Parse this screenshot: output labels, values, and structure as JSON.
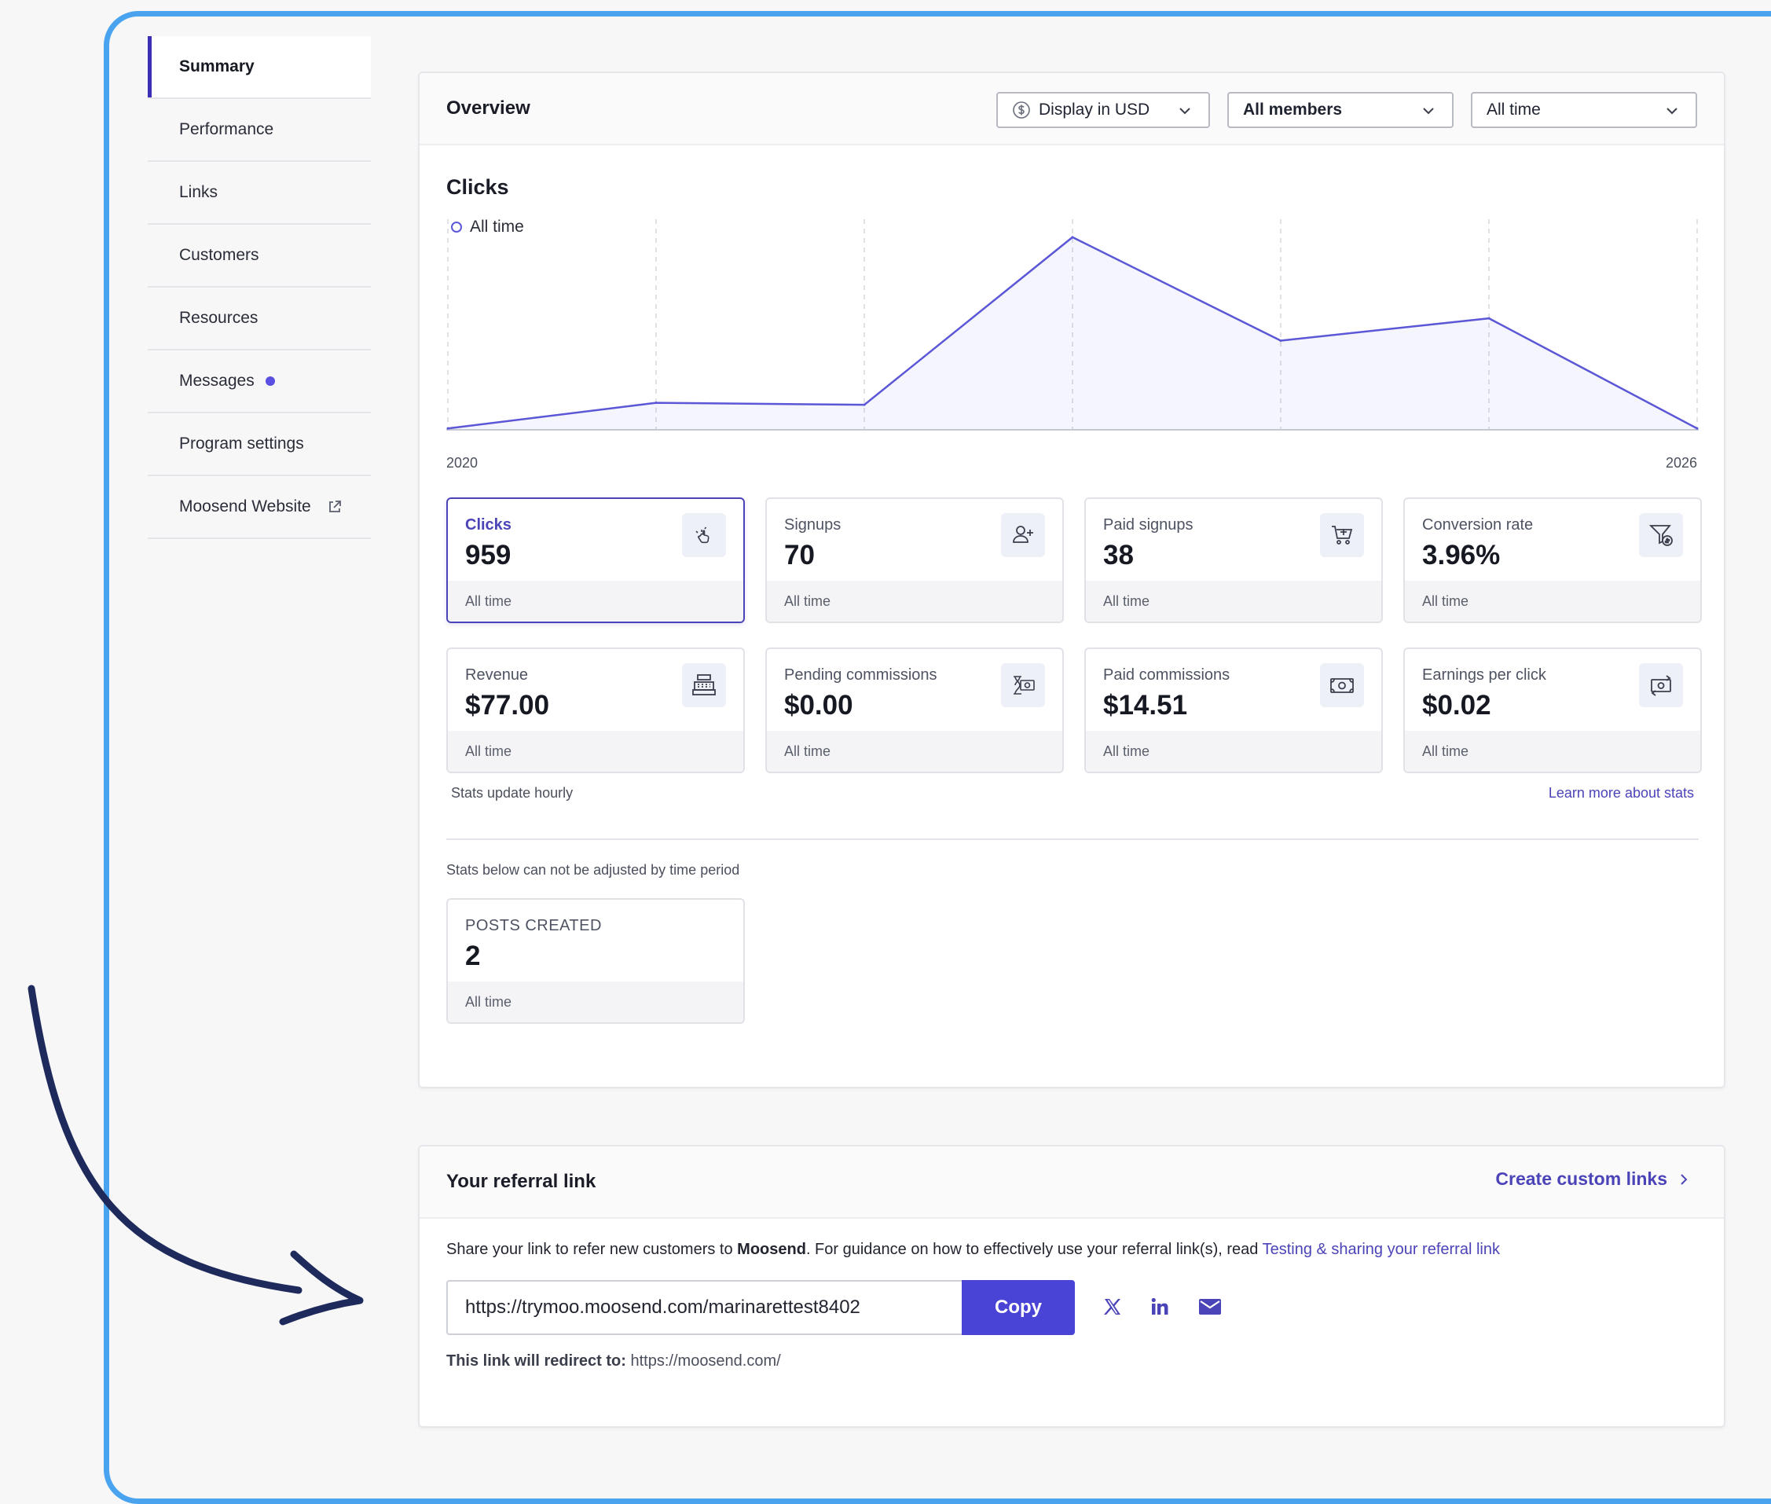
{
  "sidebar": {
    "items": [
      {
        "label": "Summary"
      },
      {
        "label": "Performance"
      },
      {
        "label": "Links"
      },
      {
        "label": "Customers"
      },
      {
        "label": "Resources"
      },
      {
        "label": "Messages"
      },
      {
        "label": "Program settings"
      },
      {
        "label": "Moosend Website"
      }
    ]
  },
  "overview": {
    "title": "Overview",
    "filters": {
      "currency": "Display in USD",
      "members": "All members",
      "period": "All time"
    },
    "chart_title": "Clicks",
    "legend": "All time",
    "x_start": "2020",
    "x_end": "2026"
  },
  "chart_data": {
    "type": "area",
    "title": "Clicks",
    "series": [
      {
        "name": "All time",
        "values": [
          2,
          40,
          37,
          285,
          132,
          165,
          2
        ]
      }
    ],
    "x": [
      "2020",
      "",
      "",
      "",
      "",
      "",
      "2026"
    ],
    "x_tick_labels": [
      "2020",
      "2026"
    ],
    "ylim": [
      0,
      300
    ],
    "grid": "vertical-dashed",
    "color": "#5b57d6"
  },
  "stats": [
    {
      "label": "Clicks",
      "value": "959",
      "period": "All time",
      "icon": "pointer-click-icon"
    },
    {
      "label": "Signups",
      "value": "70",
      "period": "All time",
      "icon": "user-plus-icon"
    },
    {
      "label": "Paid signups",
      "value": "38",
      "period": "All time",
      "icon": "cart-plus-icon"
    },
    {
      "label": "Conversion rate",
      "value": "3.96%",
      "period": "All time",
      "icon": "funnel-dollar-icon"
    },
    {
      "label": "Revenue",
      "value": "$77.00",
      "period": "All time",
      "icon": "cash-register-icon"
    },
    {
      "label": "Pending commissions",
      "value": "$0.00",
      "period": "All time",
      "icon": "pending-money-icon"
    },
    {
      "label": "Paid commissions",
      "value": "$14.51",
      "period": "All time",
      "icon": "banknote-icon"
    },
    {
      "label": "Earnings per click",
      "value": "$0.02",
      "period": "All time",
      "icon": "money-transfer-icon"
    }
  ],
  "notes": {
    "update": "Stats update hourly",
    "learn_more": "Learn more about stats",
    "fixed": "Stats below can not be adjusted by time period"
  },
  "posts": {
    "label": "POSTS CREATED",
    "value": "2",
    "period": "All time"
  },
  "referral": {
    "title": "Your referral link",
    "create_link": "Create custom links",
    "share_pre": "Share your link to refer new customers to ",
    "brand": "Moosend",
    "share_mid": ". For guidance on how to effectively use your referral link(s), read ",
    "guide_link": "Testing & sharing your referral link",
    "url": "https://trymoo.moosend.com/marinarettest8402",
    "copy_label": "Copy",
    "redirect_label": "This link will redirect to:",
    "redirect_url": "https://moosend.com/"
  },
  "colors": {
    "accent": "#4b44b8",
    "frame": "#4aa3ee",
    "button": "#4a44d6",
    "arrow": "#1e2a5c"
  }
}
